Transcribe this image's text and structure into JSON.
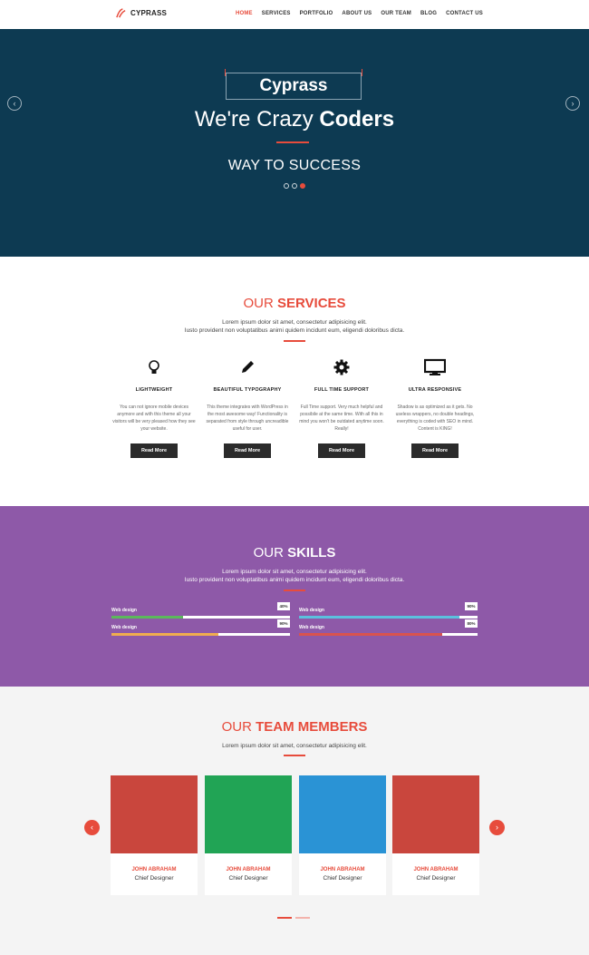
{
  "nav": {
    "brand": "CYPRASS",
    "items": [
      {
        "label": "HOME",
        "active": true
      },
      {
        "label": "SERVICES",
        "active": false
      },
      {
        "label": "PORTFOLIO",
        "active": false
      },
      {
        "label": "ABOUT US",
        "active": false
      },
      {
        "label": "OUR TEAM",
        "active": false
      },
      {
        "label": "BLOG",
        "active": false
      },
      {
        "label": "CONTACT US",
        "active": false
      }
    ]
  },
  "hero": {
    "title": "Cyprass",
    "subtitle_light": "We're Crazy ",
    "subtitle_bold": "Coders",
    "tagline": "WAY TO SUCCESS",
    "prev_icon": "chevron-left-icon",
    "next_icon": "chevron-right-icon",
    "active_slide": 3
  },
  "services": {
    "title_light": "OUR ",
    "title_bold": "SERVICES",
    "text_line1": "Lorem ipsum dolor sit amet, consectetur adipisicing elit.",
    "text_line2": "Iusto provident non voluptatibus animi quidem incidunt eum, eligendi doloribus dicta.",
    "items": [
      {
        "icon": "lightbulb-icon",
        "title": "LIGHTWEIGHT",
        "text": "You can not ignore mobile devices anymore and with this theme all your visitors will be very pleased how they see your website.",
        "button": "Read More"
      },
      {
        "icon": "pencil-icon",
        "title": "BEAUTIFUL TYPOGRAPHY",
        "text": "This theme integrates with WordPress in the most awesome way! Functionality is separated from style through uncreadible useful for user.",
        "button": "Read More"
      },
      {
        "icon": "gear-icon",
        "title": "FULL TIME SUPPORT",
        "text": "Full Time support. Very much helpful and possibile at the same time. With all this in mind you won't be outdated anytime soon. Really!",
        "button": "Read More"
      },
      {
        "icon": "monitor-icon",
        "title": "ULTRA RESPONSIVE",
        "text": "Shadow is as optimized as it gets. No useless wrappers, no double headings, everything is coded with SEO in mind. Content is KING!",
        "button": "Read More"
      }
    ]
  },
  "skills": {
    "title_light": "OUR ",
    "title_bold": "SKILLS",
    "text_line1": "Lorem ipsum dolor sit amet, consectetur adipisicing elit.",
    "text_line2": "Iusto provident non voluptatibus animi quidem incidunt eum, eligendi doloribus dicta.",
    "bars": [
      {
        "label": "Web design",
        "pct_label": "40%",
        "value": 0.4,
        "color": "#5cb85c"
      },
      {
        "label": "Web design",
        "pct_label": "90%",
        "value": 0.6,
        "color": "#f0ad4e"
      },
      {
        "label": "Web design",
        "pct_label": "90%",
        "value": 0.9,
        "color": "#5bc0de"
      },
      {
        "label": "Web design",
        "pct_label": "80%",
        "value": 0.8,
        "color": "#d9534f"
      }
    ]
  },
  "team": {
    "title_light": "OUR ",
    "title_bold": "TEAM MEMBERS",
    "text": "Lorem ipsum dolor sit amet, consectetur adipisicing elit.",
    "prev_icon": "chevron-left-icon",
    "next_icon": "chevron-right-icon",
    "members": [
      {
        "name": "JOHN ABRAHAM",
        "role": "Chief Designer",
        "color": "#c9463d"
      },
      {
        "name": "JOHN ABRAHAM",
        "role": "Chief Designer",
        "color": "#21a455"
      },
      {
        "name": "JOHN ABRAHAM",
        "role": "Chief Designer",
        "color": "#2a93d5"
      },
      {
        "name": "JOHN ABRAHAM",
        "role": "Chief Designer",
        "color": "#c9463d"
      }
    ]
  },
  "colors": {
    "accent": "#e74c3c",
    "hero_bg": "#0d3a52",
    "skills_bg": "#8e59a8"
  }
}
